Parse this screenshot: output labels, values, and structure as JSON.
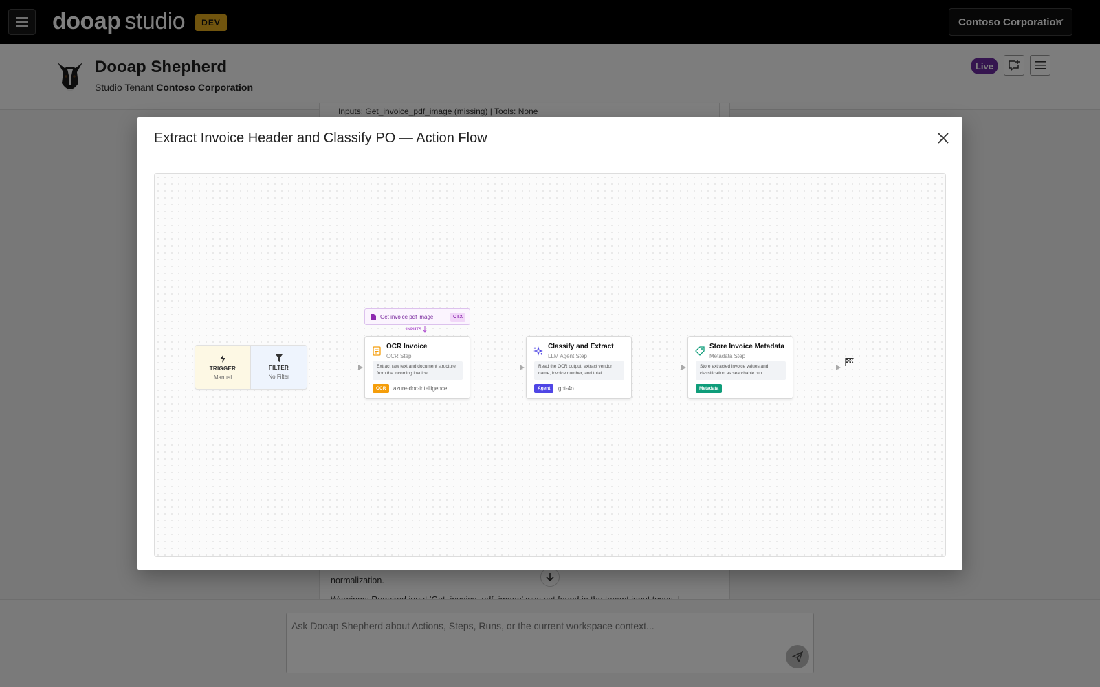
{
  "app": {
    "brand_main": "dooap",
    "brand_sub": "studio",
    "env_badge": "DEV"
  },
  "tenant_selector": {
    "value": "Contoso Corporation"
  },
  "header": {
    "title": "Dooap Shepherd",
    "tenant_prefix": "Studio Tenant",
    "tenant_name": "Contoso Corporation",
    "status_badge": "Live"
  },
  "chat_background": {
    "inputs_line": "Inputs: Get_invoice_pdf_image (missing) | Tools: None",
    "para_line": "normalization.",
    "warning_line": "Warnings: Required input 'Get_invoice_pdf_image' was not found in the tenant input types. I"
  },
  "composer": {
    "placeholder": "Ask Dooap Shepherd about Actions, Steps, Runs, or the current workspace context..."
  },
  "modal": {
    "title": "Extract Invoice Header and Classify PO — Action Flow",
    "flow": {
      "trigger": {
        "label": "TRIGGER",
        "value": "Manual"
      },
      "filter": {
        "label": "FILTER",
        "value": "No Filter"
      },
      "context_input": {
        "label": "Get invoice pdf image",
        "tag": "CTX",
        "inputs_label": "INPUTS"
      },
      "steps": [
        {
          "title": "OCR Invoice",
          "type": "OCR Step",
          "description": "Extract raw text and document structure from the incoming invoice...",
          "tag": "OCR",
          "model": "azure-doc-intelligence",
          "color": "#f59e0b",
          "icon": "document-icon"
        },
        {
          "title": "Classify and Extract",
          "type": "LLM Agent Step",
          "description": "Read the OCR output, extract vendor name, invoice number, and total...",
          "tag": "Agent",
          "model": "gpt-4o",
          "color": "#4f46e5",
          "icon": "sparkle-icon"
        },
        {
          "title": "Store Invoice Metadata",
          "type": "Metadata Step",
          "description": "Store extracted invoice values and classification as searchable run...",
          "tag": "Metadata",
          "model": "",
          "color": "#0f9d7a",
          "icon": "tag-icon"
        }
      ]
    }
  },
  "colors": {
    "topbar": "#000000",
    "dev_badge": "#e0a91c",
    "live_badge": "#6b2a9f",
    "ctx_accent": "#7a2a9e"
  }
}
